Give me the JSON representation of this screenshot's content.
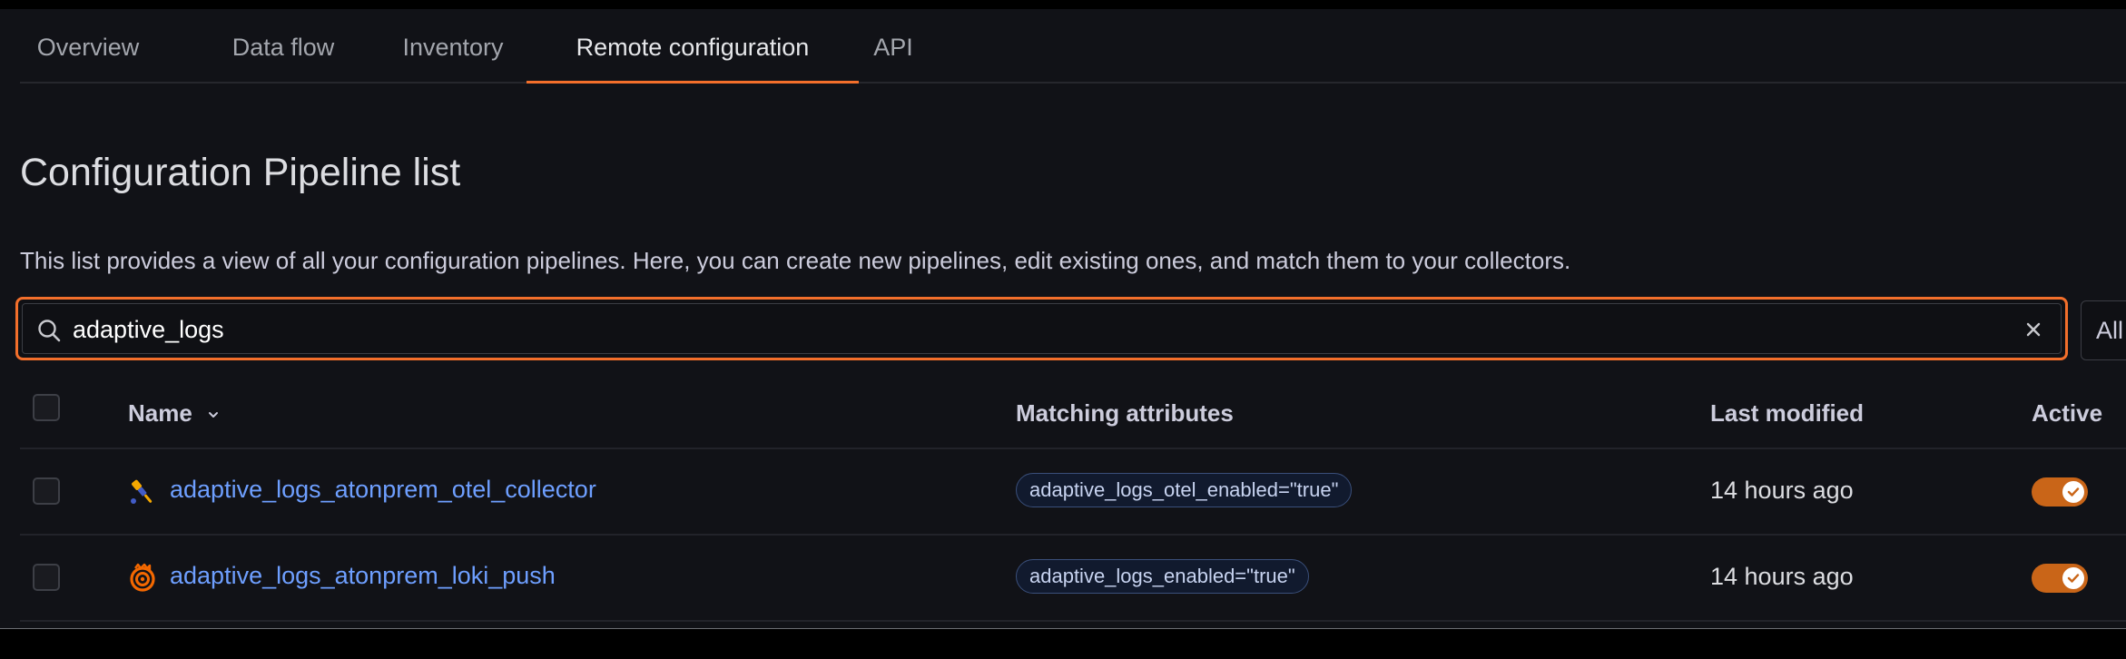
{
  "tabs": [
    {
      "label": "Overview",
      "active": false
    },
    {
      "label": "Data flow",
      "active": false
    },
    {
      "label": "Inventory",
      "active": false
    },
    {
      "label": "Remote configuration",
      "active": true
    },
    {
      "label": "API",
      "active": false
    }
  ],
  "page": {
    "title": "Configuration Pipeline list",
    "description": "This list provides a view of all your configuration pipelines. Here, you can create new pipelines, edit existing ones, and match them to your collectors."
  },
  "search": {
    "value": "adaptive_logs",
    "icon": "search-icon",
    "clear_icon": "close-icon"
  },
  "filter": {
    "label": "All"
  },
  "table": {
    "columns": {
      "name": "Name",
      "matching_attributes": "Matching attributes",
      "last_modified": "Last modified",
      "active": "Active"
    },
    "rows": [
      {
        "icon": "otel-collector-icon",
        "name": "adaptive_logs_atonprem_otel_collector",
        "matching_attribute": "adaptive_logs_otel_enabled=\"true\"",
        "last_modified": "14 hours ago",
        "active": true
      },
      {
        "icon": "loki-icon",
        "name": "adaptive_logs_atonprem_loki_push",
        "matching_attribute": "adaptive_logs_enabled=\"true\"",
        "last_modified": "14 hours ago",
        "active": true
      }
    ]
  },
  "colors": {
    "accent": "#f36f2b",
    "link": "#6e9fff",
    "toggle_on": "#c96518",
    "background": "#111217"
  }
}
